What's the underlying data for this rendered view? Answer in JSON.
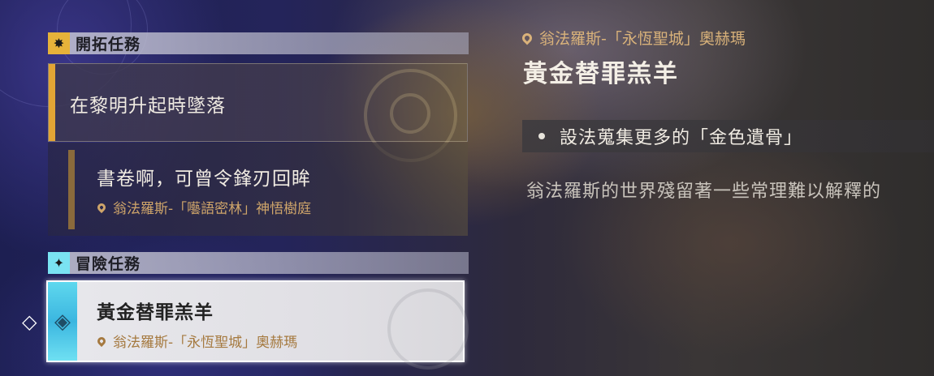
{
  "sections": [
    {
      "title": "開拓任務",
      "icon": "trailblaze-mission-icon"
    },
    {
      "title": "冒險任務",
      "icon": "adventure-mission-icon"
    }
  ],
  "trailblaze": {
    "main_quest": {
      "title": "在黎明升起時墜落"
    },
    "sub_quest": {
      "title": "書卷啊，可曾令鋒刃回眸",
      "location": "翁法羅斯-「囈語密林」神悟樹庭"
    }
  },
  "adventure": {
    "selected_quest": {
      "title": "黃金替罪羔羊",
      "location": "翁法羅斯-「永恆聖城」奧赫瑪"
    }
  },
  "detail": {
    "location": "翁法羅斯-「永恆聖城」奧赫瑪",
    "title": "黃金替罪羔羊",
    "objective": "設法蒐集更多的「金色遺骨」",
    "description": "翁法羅斯的世界殘留著一些常理難以解釋的"
  },
  "colors": {
    "trailblaze_accent": "#e2a535",
    "adventure_accent": "#3bb6e0",
    "location_text": "#cfa56a"
  }
}
